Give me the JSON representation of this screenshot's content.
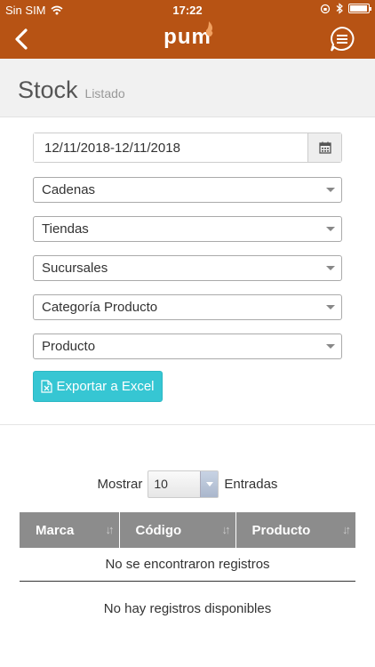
{
  "status_bar": {
    "carrier": "Sin SIM",
    "time": "17:22",
    "battery_level": 0.95
  },
  "nav": {
    "logo": "pum",
    "back_icon": "chevron-left-icon",
    "menu_icon": "chat-menu-icon"
  },
  "page": {
    "title": "Stock",
    "subtitle": "Listado"
  },
  "filters": {
    "date_range": "12/11/2018-12/11/2018",
    "selects": [
      "Cadenas",
      "Tiendas",
      "Sucursales",
      "Categoría Producto",
      "Producto"
    ]
  },
  "export_label": "Exportar a Excel",
  "table": {
    "length_label_before": "Mostrar",
    "length_value": "10",
    "length_label_after": "Entradas",
    "columns": [
      "Marca",
      "Código",
      "Producto"
    ],
    "empty_message": "No se encontraron registros",
    "info": "No hay registros disponibles"
  },
  "colors": {
    "brand": "#b75314",
    "accent_button": "#36c6d3",
    "table_header": "#8c8c8c"
  }
}
